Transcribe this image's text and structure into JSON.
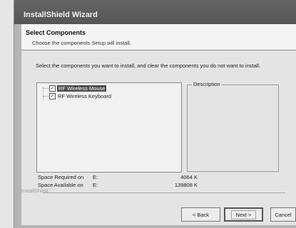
{
  "window": {
    "title": "InstallShield Wizard"
  },
  "header": {
    "title": "Select Components",
    "subtitle": "Choose the components Setup will install."
  },
  "instructions": "Select the components you want to install, and clear the components you do not want to install.",
  "components": [
    {
      "label": "RF Wireless Mouse",
      "checked": true,
      "selected": true
    },
    {
      "label": "RF Wireless Keyboard",
      "checked": true,
      "selected": false
    }
  ],
  "description": {
    "legend": "Description"
  },
  "space": {
    "required": {
      "label": "Space Required on",
      "drive": "E:",
      "value": "4064 K"
    },
    "available": {
      "label": "Space Available on",
      "drive": "E:",
      "value": "139808 K"
    }
  },
  "brand": "InstallShield",
  "buttons": {
    "back": "< Back",
    "next": "Next >",
    "cancel": "Cancel"
  }
}
